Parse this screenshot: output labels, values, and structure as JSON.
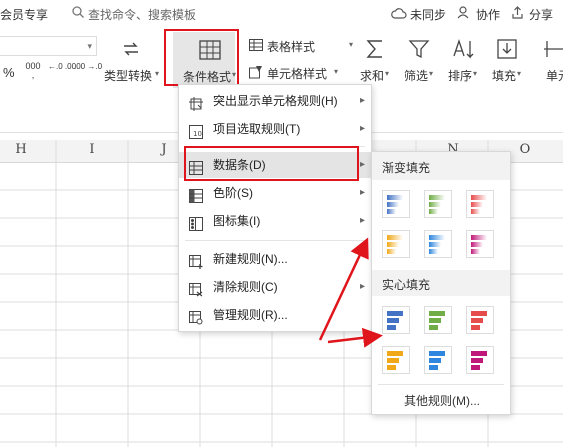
{
  "topbar": {
    "member": "会员专享",
    "search_placeholder": "查找命令、搜索模板",
    "sync": "未同步",
    "collab": "协作",
    "share": "分享"
  },
  "ribbon": {
    "type_convert": "类型转换",
    "conditional_format": "条件格式",
    "table_style": "表格样式",
    "cell_style": "单元格样式",
    "sum": "求和",
    "filter": "筛选",
    "sort": "排序",
    "fill": "填充",
    "cell": "单元",
    "percent": "%",
    "thousands": "000",
    "dec_inc": "←.0 .00",
    "dec_dec": ".00 →.0"
  },
  "columns": [
    "H",
    "I",
    "J",
    "N",
    "O"
  ],
  "menu": {
    "items": [
      {
        "label": "突出显示单元格规则(H)",
        "icon": "highlight-rules-icon",
        "submenu": true
      },
      {
        "label": "项目选取规则(T)",
        "icon": "top-bottom-rules-icon",
        "submenu": true
      },
      {
        "label": "数据条(D)",
        "icon": "data-bars-icon",
        "submenu": true,
        "highlighted": true
      },
      {
        "label": "色阶(S)",
        "icon": "color-scales-icon",
        "submenu": true
      },
      {
        "label": "图标集(I)",
        "icon": "icon-sets-icon",
        "submenu": true
      },
      {
        "label": "新建规则(N)...",
        "icon": "new-rule-icon",
        "submenu": false
      },
      {
        "label": "清除规则(C)",
        "icon": "clear-rules-icon",
        "submenu": true
      },
      {
        "label": "管理规则(R)...",
        "icon": "manage-rules-icon",
        "submenu": false
      }
    ]
  },
  "submenu": {
    "gradient_header": "渐变填充",
    "solid_header": "实心填充",
    "more_rules": "其他规则(M)...",
    "colors": [
      "#4472c4",
      "#70ad47",
      "#e74c4c",
      "#f0a818",
      "#2e86de",
      "#c0187a"
    ]
  },
  "annotation_color": "#e0141b"
}
